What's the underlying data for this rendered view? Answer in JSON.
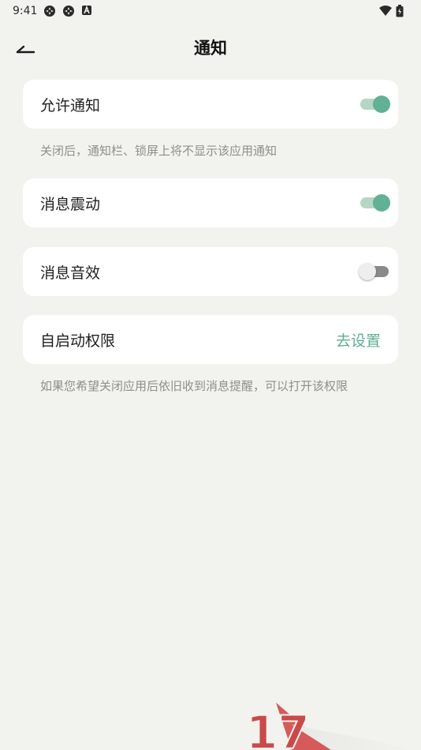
{
  "status_bar": {
    "time": "9:41",
    "icons_left": [
      "settings-icon",
      "settings-icon",
      "app-a-icon"
    ],
    "icons_right": [
      "wifi-icon",
      "battery-icon"
    ]
  },
  "header": {
    "title": "通知",
    "back_icon": "back-arrow-icon"
  },
  "settings": {
    "allow_notifications": {
      "label": "允许通知",
      "enabled": true
    },
    "allow_hint": "关闭后，通知栏、锁屏上将不显示该应用通知",
    "vibration": {
      "label": "消息震动",
      "enabled": true
    },
    "sound": {
      "label": "消息音效",
      "enabled": false
    },
    "autostart": {
      "label": "自启动权限",
      "action_label": "去设置"
    },
    "autostart_hint": "如果您希望关闭应用后依旧收到消息提醒，可以打开该权限"
  },
  "watermark": {
    "text": "17"
  },
  "colors": {
    "accent": "#5fae93",
    "toggle_on_knob": "#62b096",
    "toggle_on_track": "#b3d6c5",
    "toggle_off_track": "#8a8a8a",
    "background": "#f2f2ee",
    "card": "#ffffff",
    "hint": "#8f8f8a"
  }
}
